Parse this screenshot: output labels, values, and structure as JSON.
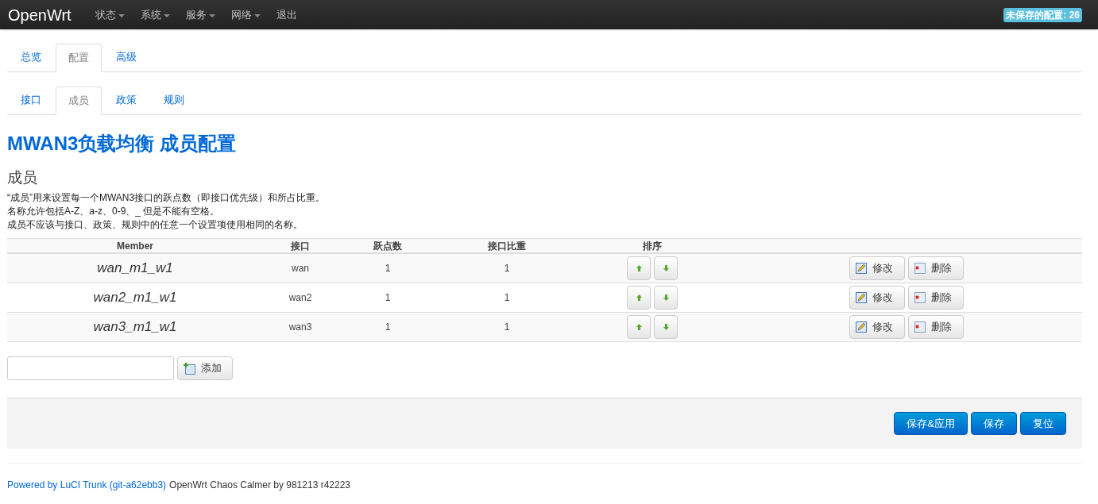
{
  "navbar": {
    "brand": "OpenWrt",
    "menu": [
      {
        "label": "状态",
        "dropdown": true
      },
      {
        "label": "系统",
        "dropdown": true
      },
      {
        "label": "服务",
        "dropdown": true
      },
      {
        "label": "网络",
        "dropdown": true
      },
      {
        "label": "退出",
        "dropdown": false
      }
    ],
    "unsaved_badge": "未保存的配置: 26"
  },
  "tabs": [
    {
      "label": "总览",
      "selected": false
    },
    {
      "label": "配置",
      "selected": true
    },
    {
      "label": "高级",
      "selected": false
    }
  ],
  "subtabs": [
    {
      "label": "接口",
      "selected": false
    },
    {
      "label": "成员",
      "selected": true
    },
    {
      "label": "政策",
      "selected": false
    },
    {
      "label": "规则",
      "selected": false
    }
  ],
  "page_title": "MWAN3负载均衡 成员配置",
  "section": {
    "title": "成员",
    "description": [
      "“成员”用来设置每一个MWAN3接口的跃点数（即接口优先级）和所占比重。",
      "名称允许包括A-Z、a-z、0-9、_ 但是不能有空格。",
      "成员不应该与接口、政策、规则中的任意一个设置项使用相同的名称。"
    ]
  },
  "table": {
    "columns": [
      "Member",
      "接口",
      "跃点数",
      "接口比重",
      "排序"
    ],
    "rows": [
      {
        "member": "wan_m1_w1",
        "interface": "wan",
        "metric": "1",
        "weight": "1",
        "edit": "修改",
        "delete": "删除"
      },
      {
        "member": "wan2_m1_w1",
        "interface": "wan2",
        "metric": "1",
        "weight": "1",
        "edit": "修改",
        "delete": "删除"
      },
      {
        "member": "wan3_m1_w1",
        "interface": "wan3",
        "metric": "1",
        "weight": "1",
        "edit": "修改",
        "delete": "删除"
      }
    ]
  },
  "add": {
    "button": "添加"
  },
  "actions": [
    "保存&应用",
    "保存",
    "复位"
  ],
  "footer": {
    "link": "Powered by LuCI Trunk (git-a62ebb3)",
    "text": "OpenWrt Chaos Calmer by 981213 r42223"
  }
}
